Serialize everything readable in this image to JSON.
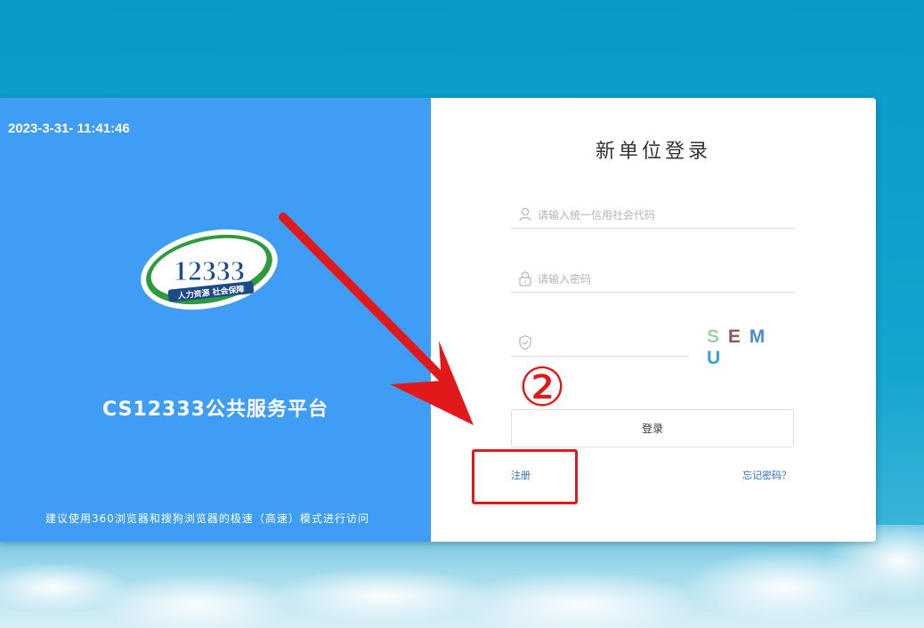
{
  "clock": "2023-3-31- 11:41:46",
  "logo": {
    "number": "12333",
    "subtitle": "人力资源  社会保障"
  },
  "platform_title": "CS12333公共服务平台",
  "browser_tip": "建议使用360浏览器和搜狗浏览器的极速（高速）模式进行访问",
  "login": {
    "title": "新单位登录",
    "credit_code_placeholder": "请输入统一信用社会代码",
    "password_placeholder": "请输入密码",
    "captcha_text": [
      "S",
      "E",
      "M",
      "U"
    ],
    "login_button": "登录",
    "register_link": "注册",
    "forgot_link": "忘记密码？"
  },
  "annotation": {
    "step_marker": "②"
  },
  "colors": {
    "left_panel": "#3f9df5",
    "annotation_red": "#e2191b",
    "link_blue": "#2f6db5"
  }
}
